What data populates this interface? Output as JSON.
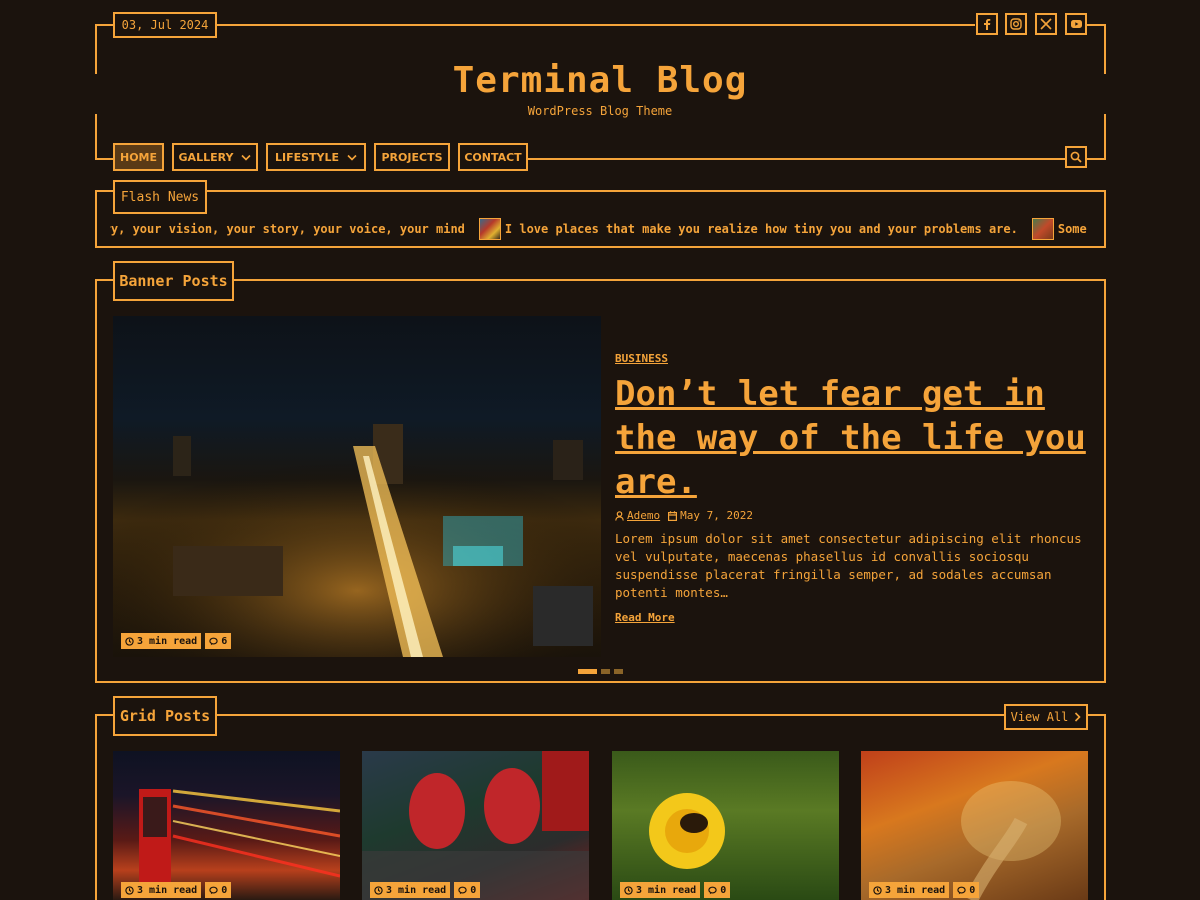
{
  "header": {
    "date": "03, Jul 2024",
    "title": "Terminal Blog",
    "description": "WordPress Blog Theme",
    "social_icons": [
      "facebook-icon",
      "instagram-icon",
      "x-icon",
      "youtube-icon"
    ]
  },
  "nav": {
    "items": [
      {
        "label": "HOME",
        "active": true,
        "dropdown": false
      },
      {
        "label": "GALLERY",
        "active": false,
        "dropdown": true
      },
      {
        "label": "LIFESTYLE",
        "active": false,
        "dropdown": true
      },
      {
        "label": "PROJECTS",
        "active": false,
        "dropdown": false
      },
      {
        "label": "CONTACT",
        "active": false,
        "dropdown": false
      }
    ]
  },
  "flash": {
    "label": "Flash News",
    "items": [
      "story, your vision, your story, your voice, your mind",
      "I love places that make you realize how tiny you and your problems are.",
      "Some bea"
    ]
  },
  "banner": {
    "section_label": "Banner Posts",
    "category": "BUSINESS",
    "title": "Don’t let fear get in the way of the life you are.",
    "author": "Ademo",
    "date": "May 7, 2022",
    "excerpt": "Lorem ipsum dolor sit amet consectetur adipiscing elit rhoncus vel vulputate, maecenas phasellus id convallis sociosqu suspendisse placerat fringilla semper, ad sodales accumsan potenti montes…",
    "read_more": "Read More",
    "read_time": "3 min read",
    "comments": "6"
  },
  "grid": {
    "section_label": "Grid Posts",
    "view_all": "View All",
    "posts": [
      {
        "read_time": "3 min read",
        "comments": "0"
      },
      {
        "read_time": "3 min read",
        "comments": "0"
      },
      {
        "read_time": "3 min read",
        "comments": "0"
      },
      {
        "read_time": "3 min read",
        "comments": "0"
      }
    ]
  },
  "colors": {
    "accent": "#f5a43a",
    "background": "#1b130d",
    "active_nav": "#5a3a16"
  }
}
